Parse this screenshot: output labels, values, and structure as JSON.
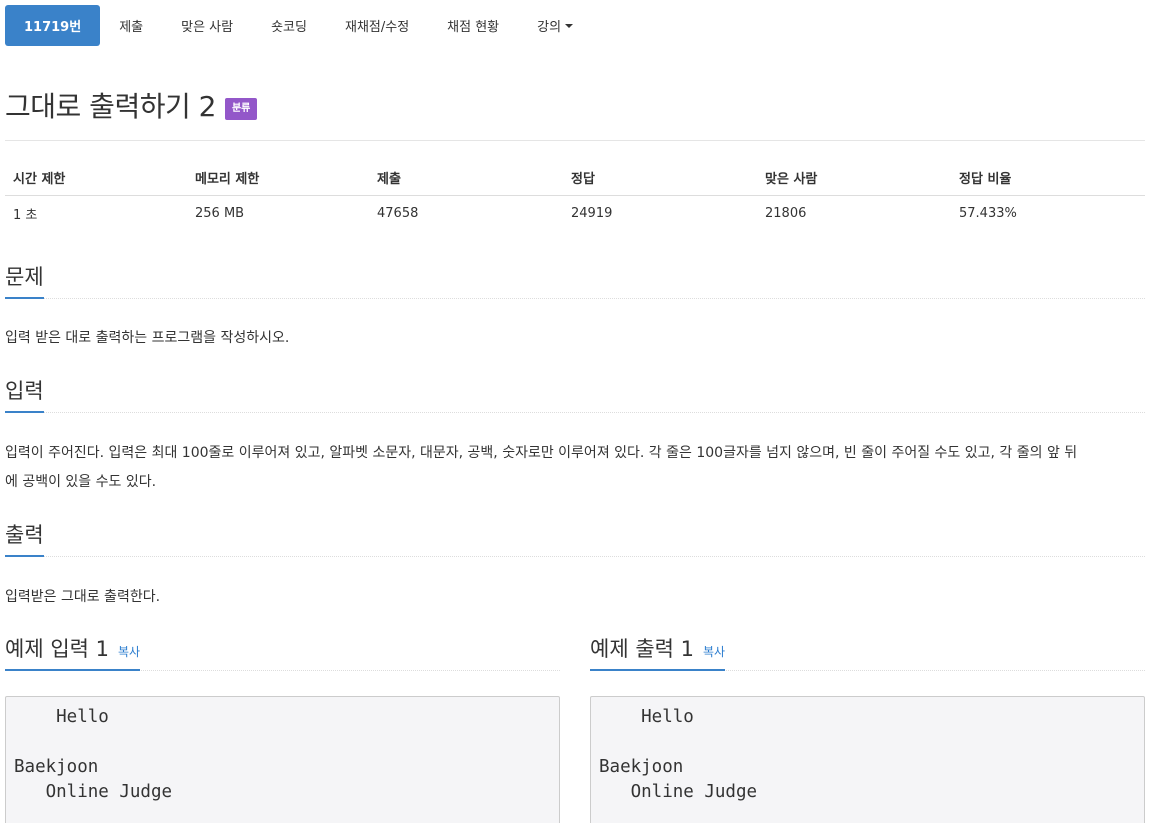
{
  "nav": {
    "tabs": [
      {
        "label": "11719번",
        "active": true
      },
      {
        "label": "제출"
      },
      {
        "label": "맞은 사람"
      },
      {
        "label": "숏코딩"
      },
      {
        "label": "재채점/수정"
      },
      {
        "label": "채점 현황"
      },
      {
        "label": "강의"
      }
    ]
  },
  "problem": {
    "title": "그대로 출력하기 2",
    "badge": "분류"
  },
  "info_table": {
    "headers": [
      "시간 제한",
      "메모리 제한",
      "제출",
      "정답",
      "맞은 사람",
      "정답 비율"
    ],
    "values": [
      "1 초",
      "256 MB",
      "47658",
      "24919",
      "21806",
      "57.433%"
    ]
  },
  "sections": {
    "description": {
      "heading": "문제",
      "text": "입력 받은 대로 출력하는 프로그램을 작성하시오."
    },
    "input": {
      "heading": "입력",
      "line1": "입력이 주어진다. 입력은 최대 100줄로 이루어져 있고, 알파벳 소문자, 대문자, 공백, 숫자로만 이루어져 있다. 각 줄은 100글자를 넘지 않으며, 빈 줄이 주어질 수도 있고, 각 줄의 앞 뒤",
      "line2": "에 공백이 있을 수도 있다."
    },
    "output": {
      "heading": "출력",
      "text": "입력받은 그대로 출력한다."
    }
  },
  "samples": {
    "input": {
      "heading": "예제 입력 1",
      "copy_label": "복사",
      "content": "    Hello\n\nBaekjoon\n   Online Judge"
    },
    "output": {
      "heading": "예제 출력 1",
      "copy_label": "복사",
      "content": "    Hello\n\nBaekjoon\n   Online Judge"
    }
  },
  "colors": {
    "accent": "#3a82c9",
    "badge": "#9357c9",
    "link": "#2a7ccf"
  }
}
